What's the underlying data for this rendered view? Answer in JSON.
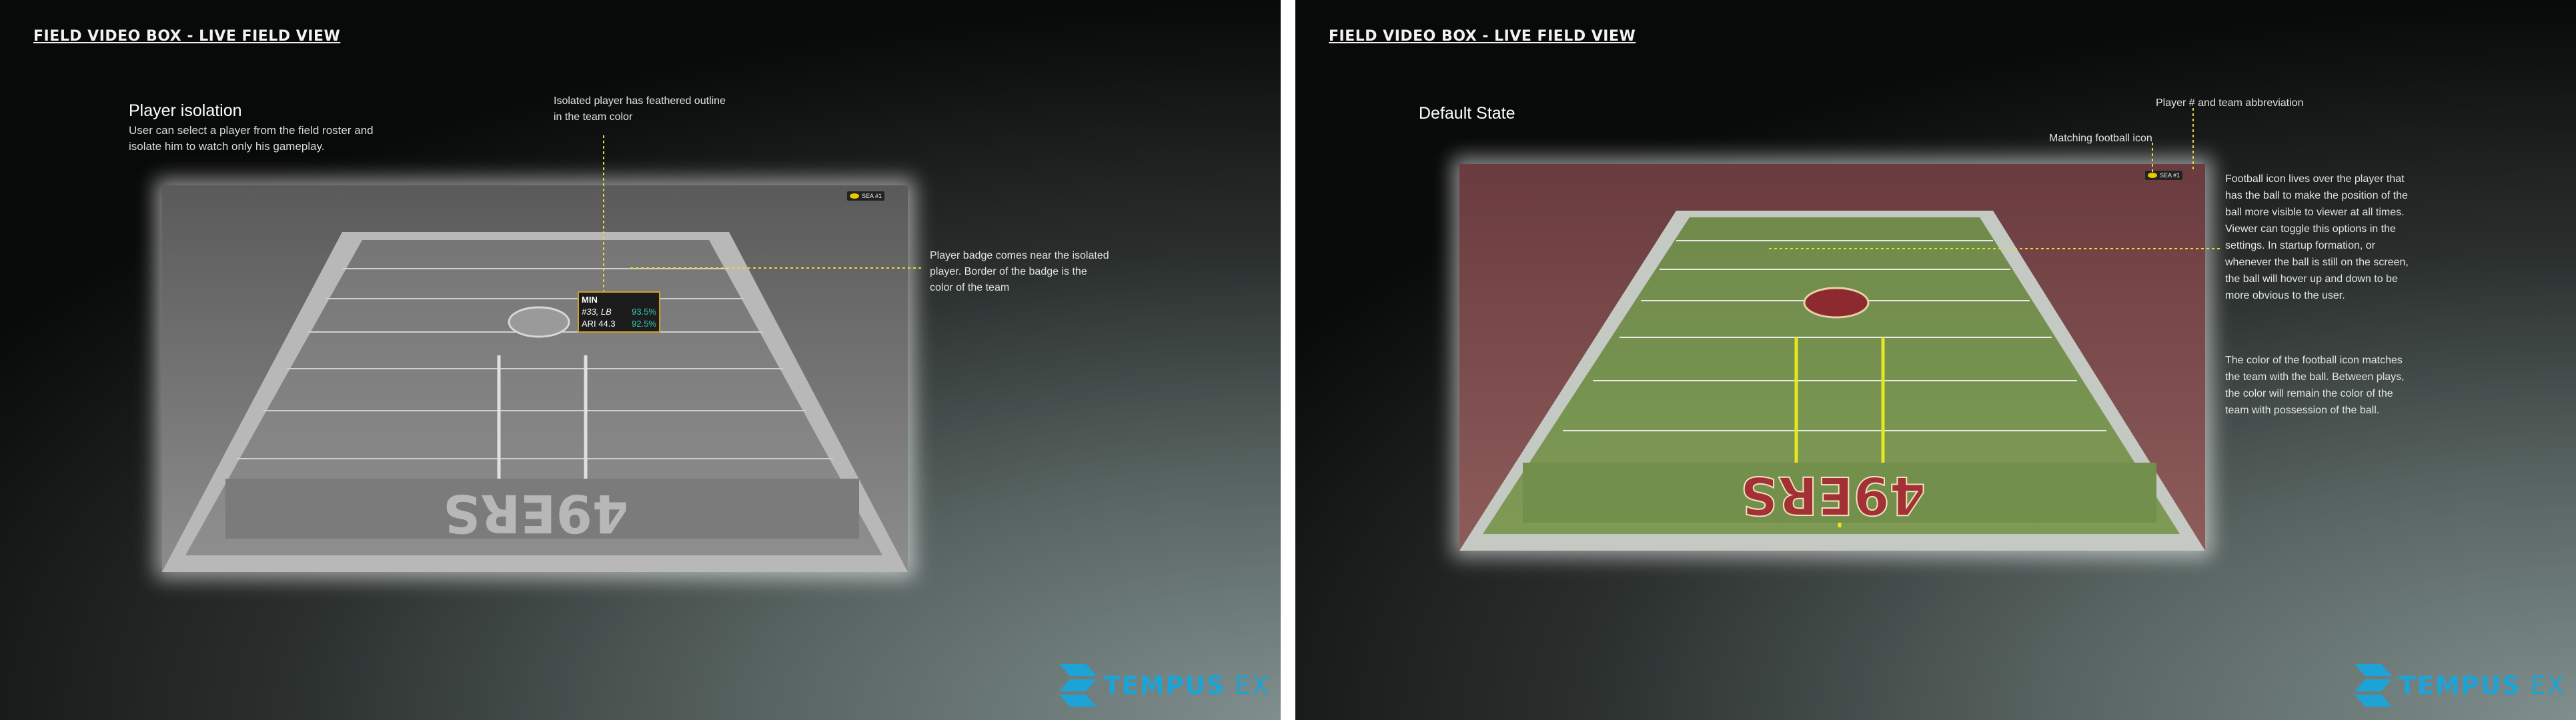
{
  "left": {
    "title": "FIELD VIDEO BOX - LIVE FIELD VIEW",
    "heading": "Player isolation",
    "description": "User can select a player from the field roster and isolate him to watch only his gameplay.",
    "note_top": "Isolated player has feathered outline in the team color",
    "note_right": "Player badge comes near the isolated player. Border of the badge is the color of the team",
    "badge": {
      "team": "MIN",
      "player": "#33, LB",
      "player_pct": "93.5%",
      "score": "ARI 44.3",
      "score_pct": "92.5%"
    },
    "mini_tag": "SEA #1",
    "end_zone_text": "49ERS",
    "logo": {
      "word1": "TEMPUS",
      "word2": "EX"
    }
  },
  "right": {
    "title": "FIELD VIDEO BOX - LIVE FIELD VIEW",
    "heading": "Default State",
    "note_player": "Player # and team abbreviation",
    "note_football": "Matching football icon",
    "description_1": "Football icon lives over the player that has the ball to make the position of the ball more visible to viewer at all times. Viewer can toggle this options in the settings. In startup formation, or whenever the ball is still on the screen, the ball will hover up and down to be more obvious to the user.",
    "description_2": "The color of the football icon matches the team with the ball. Between plays, the color will remain the color of the team with possession of the ball.",
    "mini_tag": "SEA #1",
    "end_zone_text": "49ERS",
    "logo": {
      "word1": "TEMPUS",
      "word2": "EX"
    }
  },
  "colors": {
    "accent": "#1da3d6",
    "badge_border": "#c9a227",
    "badge_pct": "#35c9b4",
    "football_icon": "#e9c800",
    "callout": "#e6d93a"
  }
}
